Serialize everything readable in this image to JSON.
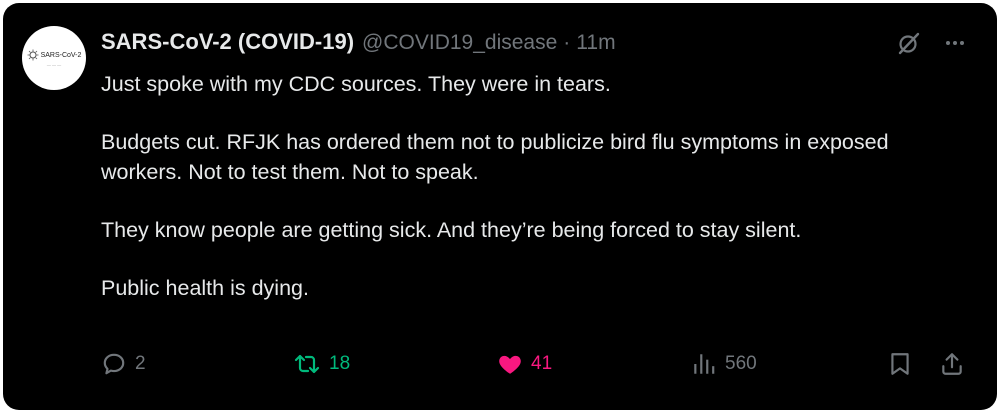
{
  "post": {
    "author_name": "SARS-CoV-2 (COVID-19)",
    "handle": "@COVID19_disease",
    "separator": "·",
    "time": "11m",
    "avatar_text": "SARS-CoV-2",
    "paragraphs": [
      "Just spoke with my CDC sources. They were in tears.",
      "Budgets cut. RFJK has ordered them not to publicize bird flu symptoms in exposed workers. Not to test them. Not to speak.",
      "They know people are getting sick. And they’re being forced to stay silent.",
      "Public health is dying."
    ]
  },
  "actions": {
    "replies": "2",
    "reposts": "18",
    "likes": "41",
    "views": "560"
  },
  "colors": {
    "background": "#000000",
    "text": "#e7e9ea",
    "muted": "#71767b",
    "repost_active": "#00ba7c",
    "like_active": "#f91880"
  },
  "icons": [
    "grok-icon",
    "more-icon",
    "reply-icon",
    "repost-icon",
    "heart-icon",
    "views-icon",
    "bookmark-icon",
    "share-icon"
  ]
}
